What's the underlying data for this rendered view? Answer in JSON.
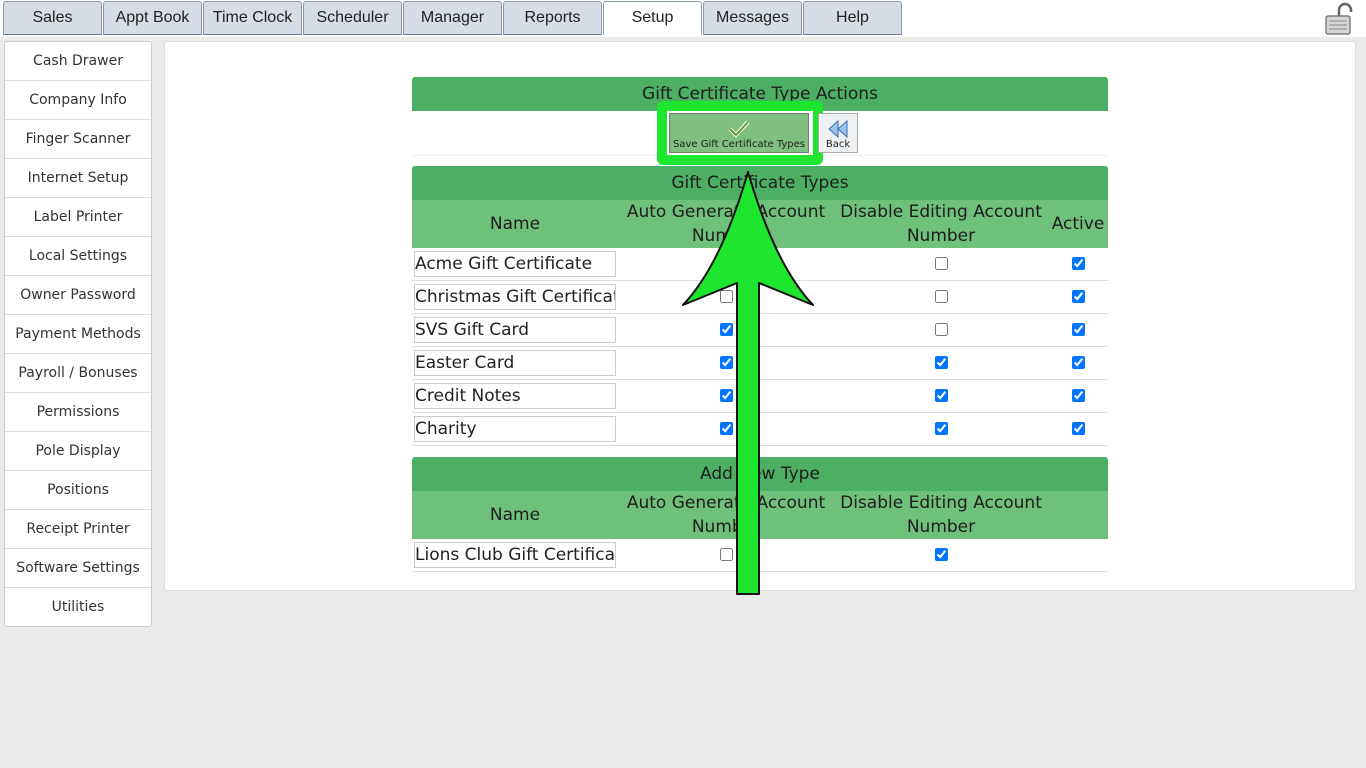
{
  "tabs": [
    {
      "label": "Sales",
      "active": false
    },
    {
      "label": "Appt Book",
      "active": false
    },
    {
      "label": "Time Clock",
      "active": false
    },
    {
      "label": "Scheduler",
      "active": false
    },
    {
      "label": "Manager",
      "active": false
    },
    {
      "label": "Reports",
      "active": false
    },
    {
      "label": "Setup",
      "active": true
    },
    {
      "label": "Messages",
      "active": false
    },
    {
      "label": "Help",
      "active": false
    }
  ],
  "sidebar": {
    "items": [
      {
        "label": "Cash Drawer"
      },
      {
        "label": "Company Info"
      },
      {
        "label": "Finger Scanner"
      },
      {
        "label": "Internet Setup"
      },
      {
        "label": "Label Printer"
      },
      {
        "label": "Local Settings"
      },
      {
        "label": "Owner Password"
      },
      {
        "label": "Payment Methods"
      },
      {
        "label": "Payroll / Bonuses"
      },
      {
        "label": "Permissions"
      },
      {
        "label": "Pole Display"
      },
      {
        "label": "Positions"
      },
      {
        "label": "Receipt Printer"
      },
      {
        "label": "Software Settings"
      },
      {
        "label": "Utilities"
      }
    ]
  },
  "actions": {
    "title": "Gift Certificate Type Actions",
    "save_label": "Save Gift Certificate Types",
    "back_label": "Back"
  },
  "types": {
    "title": "Gift Certificate Types",
    "columns": {
      "name": "Name",
      "auto_generate": "Auto Generate Account Number",
      "disable_editing": "Disable Editing Account Number",
      "active": "Active"
    },
    "rows": [
      {
        "name": "Acme Gift Certificate",
        "auto_generate": false,
        "disable_editing": false,
        "active": true
      },
      {
        "name": "Christmas Gift Certificate",
        "auto_generate": false,
        "disable_editing": false,
        "active": true
      },
      {
        "name": "SVS Gift Card",
        "auto_generate": true,
        "disable_editing": false,
        "active": true
      },
      {
        "name": "Easter Card",
        "auto_generate": true,
        "disable_editing": true,
        "active": true
      },
      {
        "name": "Credit Notes",
        "auto_generate": true,
        "disable_editing": true,
        "active": true
      },
      {
        "name": "Charity",
        "auto_generate": true,
        "disable_editing": true,
        "active": true
      }
    ]
  },
  "add_new": {
    "title": "Add New Type",
    "columns": {
      "name": "Name",
      "auto_generate": "Auto Generate Account Number",
      "disable_editing": "Disable Editing Account Number"
    },
    "row": {
      "name": "Lions Club Gift Certificate",
      "auto_generate": false,
      "disable_editing": true
    }
  },
  "colors": {
    "section_header": "#4caf63",
    "column_header": "#6fc07a",
    "highlight": "#1ee62e"
  }
}
